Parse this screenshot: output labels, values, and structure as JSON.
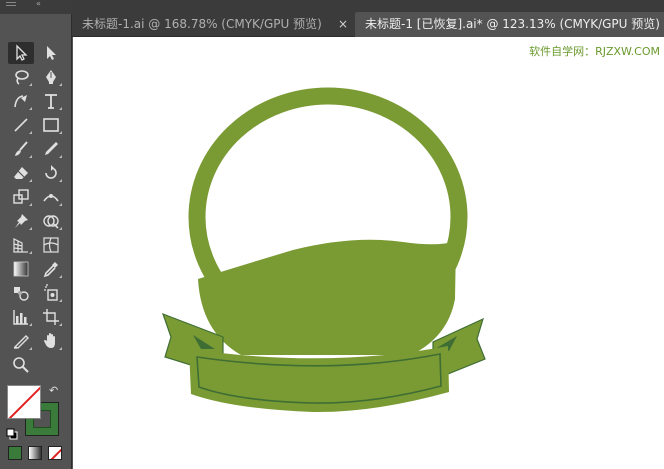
{
  "toolbar": {
    "tools": [
      {
        "name": "selection-tool",
        "icon": "selection-arrow-icon",
        "selected": true
      },
      {
        "name": "direct-selection-tool",
        "icon": "direct-selection-arrow-icon"
      },
      {
        "name": "lasso-tool",
        "icon": "lasso-icon"
      },
      {
        "name": "pen-tool",
        "icon": "pen-icon"
      },
      {
        "name": "curvature-tool",
        "icon": "curvature-pen-icon"
      },
      {
        "name": "type-tool",
        "icon": "type-icon"
      },
      {
        "name": "line-tool",
        "icon": "line-segment-icon"
      },
      {
        "name": "rectangle-tool",
        "icon": "rectangle-icon"
      },
      {
        "name": "paintbrush-tool",
        "icon": "paintbrush-icon"
      },
      {
        "name": "pencil-tool",
        "icon": "pencil-icon"
      },
      {
        "name": "eraser-tool",
        "icon": "eraser-icon"
      },
      {
        "name": "rotate-tool",
        "icon": "rotate-icon"
      },
      {
        "name": "scale-tool",
        "icon": "scale-icon"
      },
      {
        "name": "width-tool",
        "icon": "width-icon"
      },
      {
        "name": "puppet-warp-tool",
        "icon": "pin-icon"
      },
      {
        "name": "shape-builder-tool",
        "icon": "shape-builder-icon"
      },
      {
        "name": "perspective-grid-tool",
        "icon": "perspective-grid-icon"
      },
      {
        "name": "mesh-tool",
        "icon": "mesh-icon"
      },
      {
        "name": "gradient-tool",
        "icon": "gradient-icon"
      },
      {
        "name": "eyedropper-tool",
        "icon": "eyedropper-icon"
      },
      {
        "name": "blend-tool",
        "icon": "blend-icon"
      },
      {
        "name": "symbol-sprayer-tool",
        "icon": "symbol-sprayer-icon"
      },
      {
        "name": "column-graph-tool",
        "icon": "column-graph-icon"
      },
      {
        "name": "artboard-tool",
        "icon": "artboard-icon"
      },
      {
        "name": "slice-tool",
        "icon": "slice-icon"
      },
      {
        "name": "hand-tool",
        "icon": "hand-icon"
      },
      {
        "name": "zoom-tool",
        "icon": "zoom-icon"
      }
    ],
    "fill_color": "none",
    "stroke_color": "#3a7a3a"
  },
  "tabs": [
    {
      "label": "未标题-1.ai @ 168.78% (CMYK/GPU 预览)",
      "close": "×",
      "active": false
    },
    {
      "label": "未标题-1 [已恢复].ai* @ 123.13% (CMYK/GPU 预览)",
      "active": true
    }
  ],
  "canvas": {
    "watermark": "软件自学网：RJZXW.COM",
    "artwork": {
      "description_color_main": "#7a9a33",
      "description_color_dark": "#3f6e35"
    }
  }
}
